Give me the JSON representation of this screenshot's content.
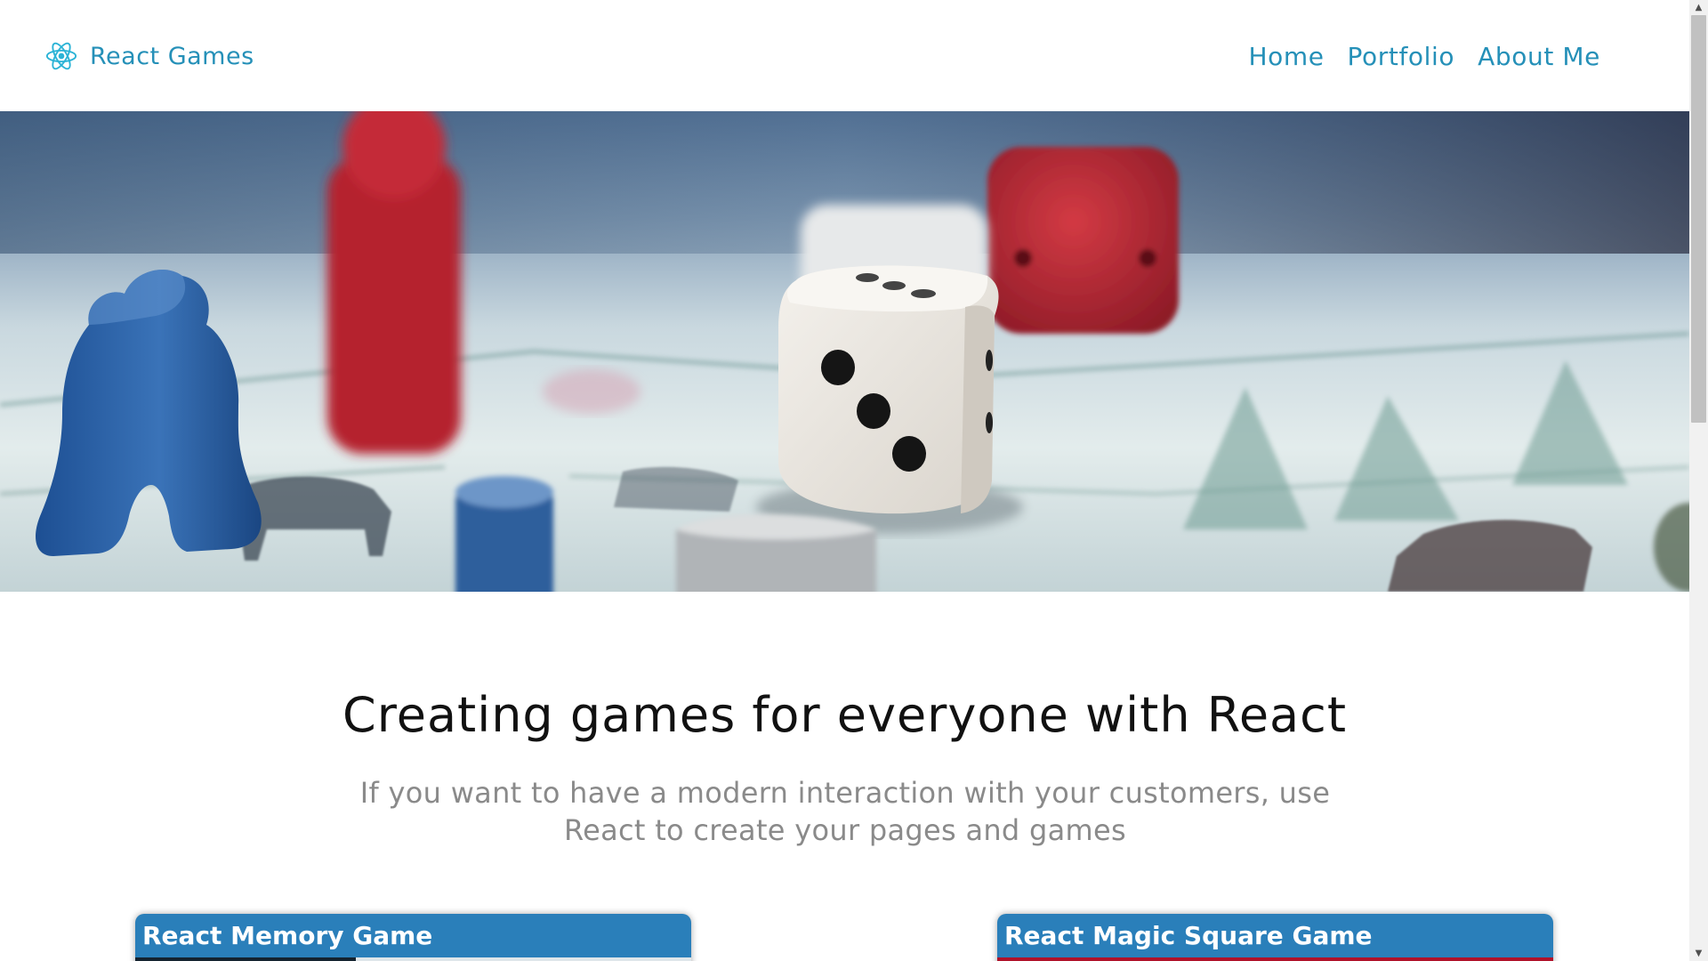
{
  "header": {
    "brand": {
      "icon": "react-atom-icon",
      "name": "React Games"
    },
    "nav": [
      {
        "label": "Home"
      },
      {
        "label": "Portfolio"
      },
      {
        "label": "About Me"
      }
    ]
  },
  "hero": {
    "image": "board-game-dice-photo"
  },
  "intro": {
    "title": "Creating games for everyone with React",
    "subtitle": "If you want to have a modern interaction with your customers, use React to create your pages and games"
  },
  "cards": [
    {
      "title": "React Memory Game"
    },
    {
      "title": "React Magic Square Game"
    }
  ],
  "scrollbar": {
    "up_icon": "▲",
    "down_icon": "▼"
  },
  "colors": {
    "accent": "#2590b8",
    "card_header": "#2a7fba",
    "title_text": "#111111",
    "subtitle_text": "#8a8a8a"
  }
}
